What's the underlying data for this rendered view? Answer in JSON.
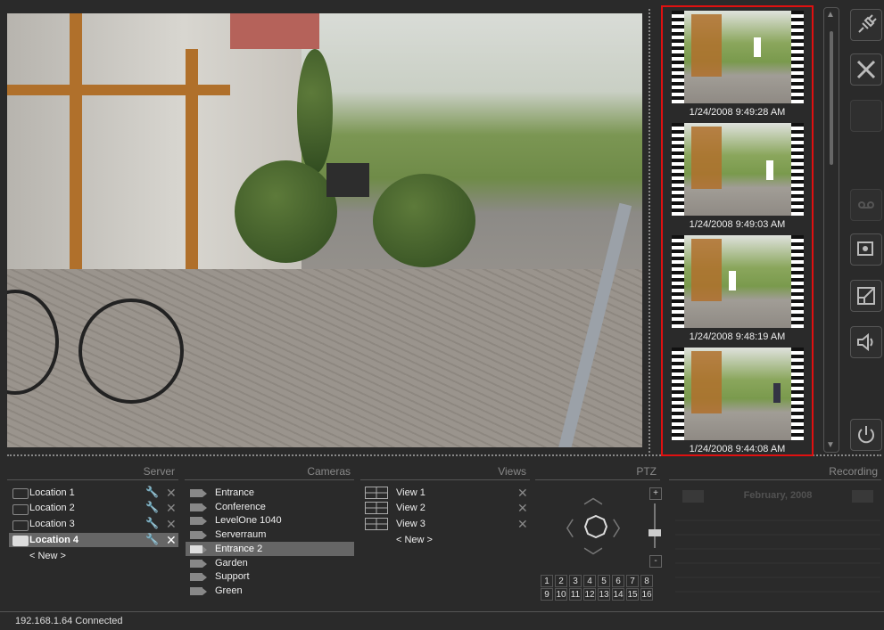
{
  "thumbnails": [
    {
      "time": "1/24/2008 9:49:28 AM"
    },
    {
      "time": "1/24/2008 9:49:03 AM"
    },
    {
      "time": "1/24/2008 9:48:19 AM"
    },
    {
      "time": "1/24/2008 9:44:08 AM"
    }
  ],
  "panels": {
    "server": "Server",
    "cameras": "Cameras",
    "views": "Views",
    "ptz": "PTZ",
    "recording": "Recording"
  },
  "servers": [
    "Location 1",
    "Location 2",
    "Location 3",
    "Location 4"
  ],
  "server_new": "< New >",
  "cameras": [
    "Entrance",
    "Conference",
    "LevelOne 1040",
    "Serverraum",
    "Entrance 2",
    "Garden",
    "Support",
    "Green"
  ],
  "views": [
    "View 1",
    "View 2",
    "View 3"
  ],
  "views_new": "< New >",
  "ptz": {
    "plus": "+",
    "minus": "-",
    "presets": [
      "1",
      "2",
      "3",
      "4",
      "5",
      "6",
      "7",
      "8",
      "9",
      "10",
      "11",
      "12",
      "13",
      "14",
      "15",
      "16"
    ]
  },
  "calendar": {
    "month": "February, 2008"
  },
  "status": {
    "text": "192.168.1.64 Connected"
  },
  "colors": {
    "accent": "#e01010",
    "selected": "#666666"
  },
  "selected": {
    "server": "Location 4",
    "camera": "Entrance 2"
  }
}
